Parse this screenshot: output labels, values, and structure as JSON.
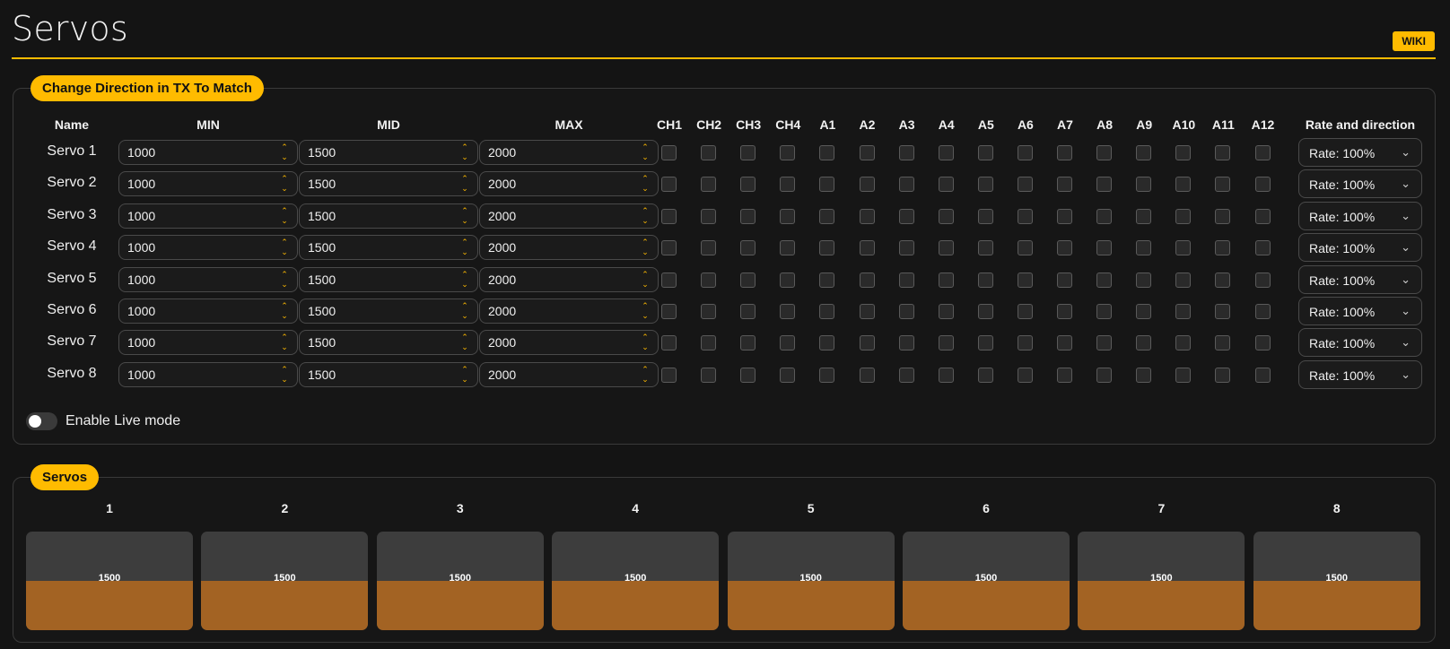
{
  "page": {
    "title": "Servos",
    "wiki_label": "WIKI"
  },
  "colors": {
    "accent": "#ffbb00",
    "bar_fill": "#a36323",
    "bar_bg": "#3d3d3d"
  },
  "config": {
    "tag": "Change Direction in TX To Match",
    "headers": {
      "name": "Name",
      "min": "MIN",
      "mid": "MID",
      "max": "MAX",
      "channels": [
        "CH1",
        "CH2",
        "CH3",
        "CH4",
        "A1",
        "A2",
        "A3",
        "A4",
        "A5",
        "A6",
        "A7",
        "A8",
        "A9",
        "A10",
        "A11",
        "A12"
      ],
      "rate": "Rate and direction"
    },
    "servos": [
      {
        "name": "Servo 1",
        "min": "1000",
        "mid": "1500",
        "max": "2000",
        "rate": "Rate: 100%"
      },
      {
        "name": "Servo 2",
        "min": "1000",
        "mid": "1500",
        "max": "2000",
        "rate": "Rate: 100%"
      },
      {
        "name": "Servo 3",
        "min": "1000",
        "mid": "1500",
        "max": "2000",
        "rate": "Rate: 100%"
      },
      {
        "name": "Servo 4",
        "min": "1000",
        "mid": "1500",
        "max": "2000",
        "rate": "Rate: 100%"
      },
      {
        "name": "Servo 5",
        "min": "1000",
        "mid": "1500",
        "max": "2000",
        "rate": "Rate: 100%"
      },
      {
        "name": "Servo 6",
        "min": "1000",
        "mid": "1500",
        "max": "2000",
        "rate": "Rate: 100%"
      },
      {
        "name": "Servo 7",
        "min": "1000",
        "mid": "1500",
        "max": "2000",
        "rate": "Rate: 100%"
      },
      {
        "name": "Servo 8",
        "min": "1000",
        "mid": "1500",
        "max": "2000",
        "rate": "Rate: 100%"
      }
    ],
    "live_mode": {
      "label": "Enable Live mode",
      "enabled": false
    }
  },
  "servos_panel": {
    "tag": "Servos",
    "bars": [
      {
        "label": "1",
        "value": "1500",
        "fill": 0.5
      },
      {
        "label": "2",
        "value": "1500",
        "fill": 0.5
      },
      {
        "label": "3",
        "value": "1500",
        "fill": 0.5
      },
      {
        "label": "4",
        "value": "1500",
        "fill": 0.5
      },
      {
        "label": "5",
        "value": "1500",
        "fill": 0.5
      },
      {
        "label": "6",
        "value": "1500",
        "fill": 0.5
      },
      {
        "label": "7",
        "value": "1500",
        "fill": 0.5
      },
      {
        "label": "8",
        "value": "1500",
        "fill": 0.5
      }
    ]
  }
}
